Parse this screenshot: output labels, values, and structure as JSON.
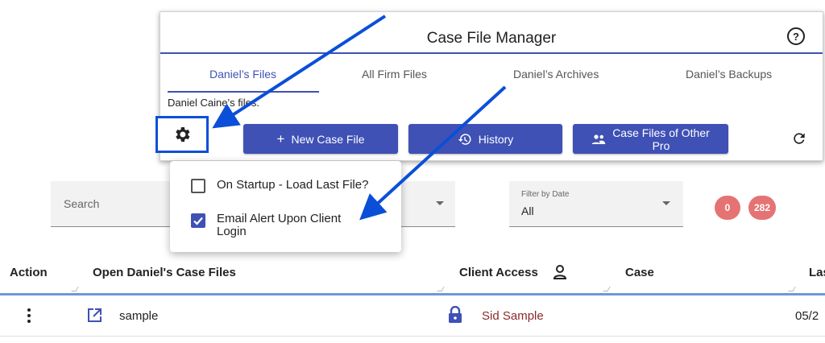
{
  "dialog": {
    "title": "Case File Manager",
    "help_glyph": "?",
    "tabs": [
      {
        "label": "Daniel’s Files",
        "active": true
      },
      {
        "label": "All Firm Files",
        "active": false
      },
      {
        "label": "Daniel’s Archives",
        "active": false
      },
      {
        "label": "Daniel’s Backups",
        "active": false
      }
    ],
    "description": "Daniel Caine’s files.",
    "buttons": {
      "new_case_file": "New Case File",
      "history": "History",
      "other_pro_line1": "Case Files of Other",
      "other_pro_line2": "Pro"
    },
    "accent": "#3f51b5",
    "highlight": "#0b4fd8"
  },
  "settings_menu": {
    "options": [
      {
        "label": "On Startup - Load Last File?",
        "checked": false
      },
      {
        "label_line1": "Email Alert Upon Client",
        "label_line2": "Login",
        "checked": true
      }
    ]
  },
  "search": {
    "placeholder": "Search"
  },
  "filter": {
    "label": "Filter by Date",
    "value": "All"
  },
  "badges": [
    "0",
    "282"
  ],
  "table": {
    "headers": {
      "action": "Action",
      "files": "Open Daniel's Case Files",
      "client_access": "Client Access",
      "case": "Case",
      "last": "Las"
    },
    "rows": [
      {
        "name": "sample",
        "client": "Sid Sample",
        "date": "05/2"
      }
    ]
  },
  "icons": [
    "gear-icon",
    "help-icon",
    "plus-icon",
    "history-icon",
    "people-icon",
    "refresh-icon",
    "user-icon",
    "open-external-icon",
    "lock-icon",
    "kebab-icon"
  ]
}
